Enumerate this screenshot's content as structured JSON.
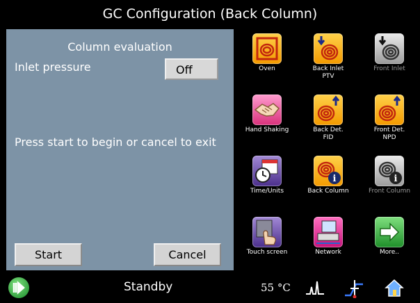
{
  "title": "GC Configuration  (Back Column)",
  "panel": {
    "heading": "Column evaluation",
    "inlet_label": "Inlet pressure",
    "inlet_value": "Off",
    "message": "Press start to begin or cancel to exit",
    "start_label": "Start",
    "cancel_label": "Cancel"
  },
  "tiles": [
    {
      "label": "Oven",
      "icon": "oven-coil-icon",
      "color": "orange",
      "enabled": true
    },
    {
      "label": "Back Inlet PTV",
      "icon": "inlet-coil-icon",
      "color": "orange",
      "enabled": true
    },
    {
      "label": "Front Inlet",
      "icon": "inlet-coil-icon",
      "color": "grey",
      "enabled": false
    },
    {
      "label": "Hand Shaking",
      "icon": "handshake-icon",
      "color": "pink",
      "enabled": true
    },
    {
      "label": "Back Det. FID",
      "icon": "detector-coil-icon",
      "color": "orange",
      "enabled": true
    },
    {
      "label": "Front Det. NPD",
      "icon": "detector-coil-icon",
      "color": "orange",
      "enabled": true
    },
    {
      "label": "Time/Units",
      "icon": "calendar-clock-icon",
      "color": "purple",
      "enabled": true
    },
    {
      "label": "Back Column",
      "icon": "column-info-icon",
      "color": "orange",
      "enabled": true
    },
    {
      "label": "Front Column",
      "icon": "column-info-icon",
      "color": "grey",
      "enabled": false
    },
    {
      "label": "Touch screen",
      "icon": "touch-hand-icon",
      "color": "purple",
      "enabled": true
    },
    {
      "label": "Network",
      "icon": "network-icon",
      "color": "mag",
      "enabled": true
    },
    {
      "label": "More..",
      "icon": "arrow-right-icon",
      "color": "green",
      "enabled": true
    }
  ],
  "status": {
    "state": "Standby",
    "temperature": "55 °C",
    "icons": [
      "run-icon",
      "chromatogram-icon",
      "ramp-icon",
      "home-icon"
    ]
  }
}
